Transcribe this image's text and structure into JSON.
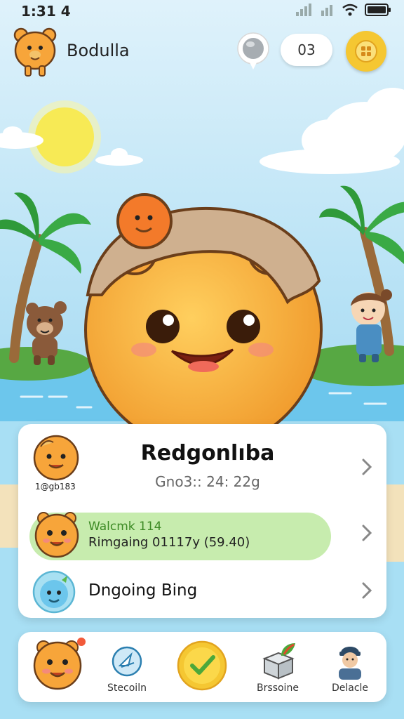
{
  "status_bar": {
    "time": "1:31 4"
  },
  "header": {
    "app_title": "Bodulla",
    "score": "03"
  },
  "card": {
    "profile": {
      "avatar_caption": "1@gb183",
      "name": "Redgonlıba",
      "subtitle": "Gno3:: 24: 22g"
    },
    "welcome": {
      "line1": "Walcmk 114",
      "line2": "Rimgaing 01117y (59.40)"
    },
    "ongoing": {
      "label": "Dngoing Bing"
    }
  },
  "bottom_nav": {
    "items": [
      {
        "label": ""
      },
      {
        "label": "Stecoiln"
      },
      {
        "label": ""
      },
      {
        "label": "Brssoine"
      },
      {
        "label": "Delacle"
      }
    ]
  },
  "colors": {
    "sky": "#bfe6f7",
    "sea": "#6cc6ec",
    "mascot": "#f7a53a",
    "accent_yellow": "#f5c732",
    "welcome_green": "#c7ecae"
  }
}
